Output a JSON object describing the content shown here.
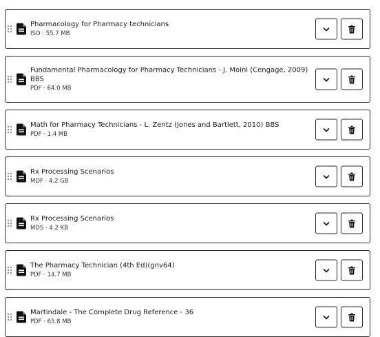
{
  "files": [
    {
      "title": "Pharmacology for Pharmacy technicians",
      "title2": "",
      "meta": "ISO · 55.7 MB"
    },
    {
      "title": "Fundamental Pharmacology for Pharmacy Technicians - J. Moini (Cengage, 2009)",
      "title2": "BBS",
      "meta": "PDF · 64.0 MB"
    },
    {
      "title": "Math for Pharmacy Technicians - L. Zentz (Jones and Bartlett, 2010) BBS",
      "title2": "",
      "meta": "PDF · 1.4 MB"
    },
    {
      "title": "Rx Processing Scenarios",
      "title2": "",
      "meta": "MDF · 4.2 GB"
    },
    {
      "title": "Rx Processing Scenarios",
      "title2": "",
      "meta": "MDS · 4.2 KB"
    },
    {
      "title": "The Pharmacy Technician (4th Ed)(gnv64)",
      "title2": "",
      "meta": "PDF · 14.7 MB"
    },
    {
      "title": "Martindale - The Complete Drug Reference - 36",
      "title2": "",
      "meta": "PDF · 65.8 MB"
    }
  ],
  "icons": {
    "file": "file-document-icon",
    "drag": "drag-handle-icon",
    "expand": "chevron-down-icon",
    "delete": "trash-icon"
  }
}
